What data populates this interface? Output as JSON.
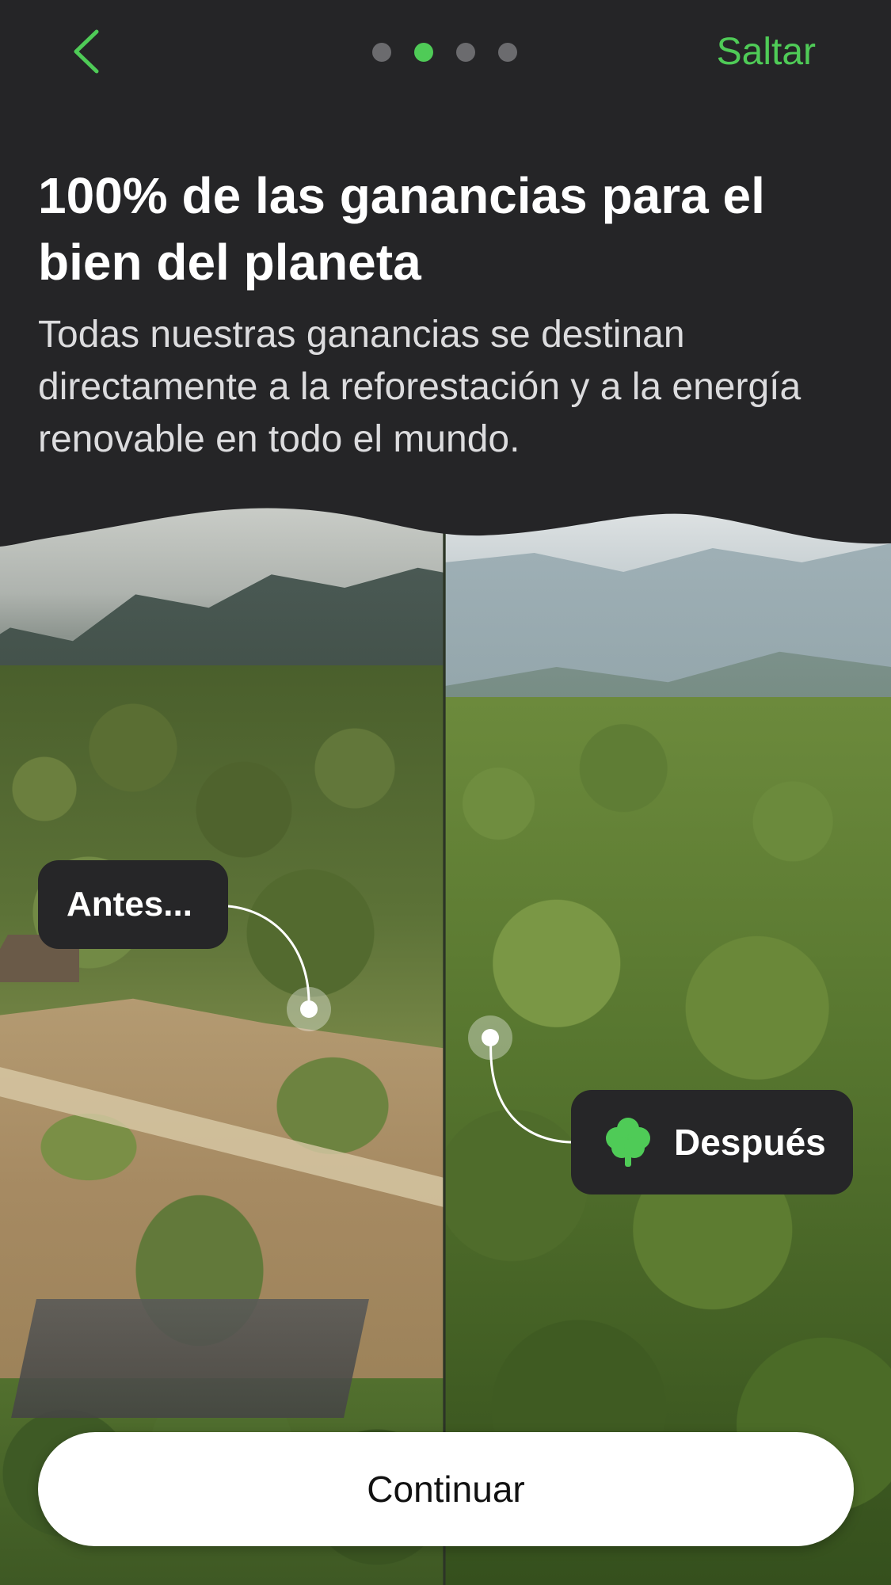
{
  "header": {
    "back_icon": "chevron-left-icon",
    "skip_label": "Saltar",
    "pager": {
      "total": 4,
      "active_index": 1
    }
  },
  "content": {
    "title": "100% de las ganancias para el bien del planeta",
    "subtitle": "Todas nuestras ganancias se destinan directamente a la reforestación y a la energía renovable en todo el mundo."
  },
  "comparison": {
    "before_label": "Antes...",
    "after_label": "Después",
    "after_icon": "tree-icon"
  },
  "footer": {
    "continue_label": "Continuar"
  },
  "colors": {
    "background": "#252527",
    "accent": "#4fcb57",
    "button_bg": "#ffffff",
    "label_bg": "#262628"
  }
}
